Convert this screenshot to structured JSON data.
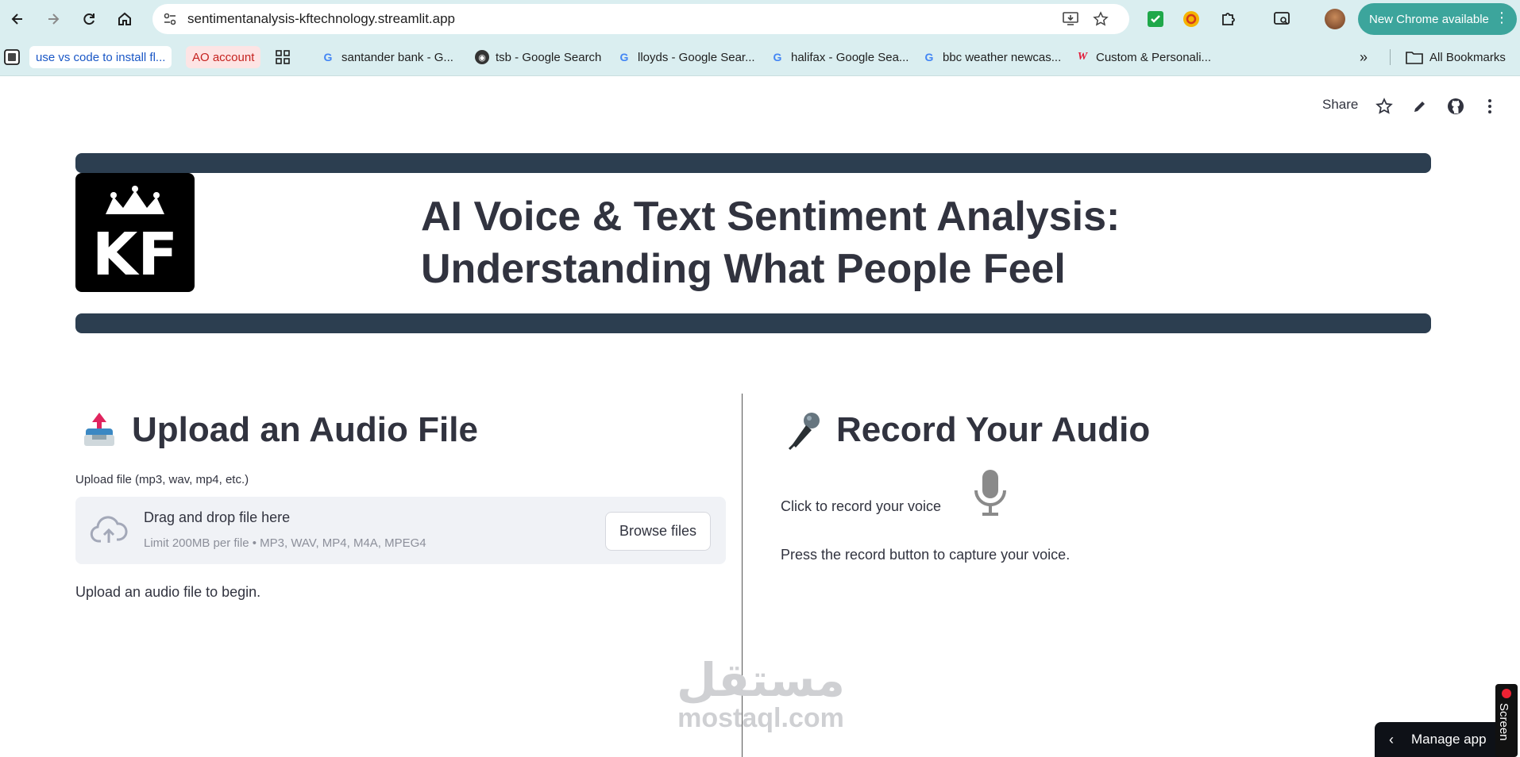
{
  "browser": {
    "url": "sentimentanalysis-kftechnology.streamlit.app",
    "update_label": "New Chrome available",
    "icons": [
      "back-arrow-icon",
      "forward-arrow-icon",
      "reload-icon",
      "home-icon",
      "site-settings-icon",
      "install-app-icon",
      "star-icon"
    ]
  },
  "bookmarks": {
    "items": [
      {
        "label": "use vs code to install fl...",
        "style": "chip-blue"
      },
      {
        "label": "AO account",
        "style": "chip-red"
      },
      {
        "label": "santander bank - G...",
        "icon": "google-icon"
      },
      {
        "label": "tsb - Google Search",
        "icon": "globe-icon"
      },
      {
        "label": "lloyds - Google Sear...",
        "icon": "google-icon"
      },
      {
        "label": "halifax - Google Sea...",
        "icon": "google-icon"
      },
      {
        "label": "bbc weather newcas...",
        "icon": "google-icon"
      },
      {
        "label": "Custom & Personali...",
        "icon": "walgreens-icon"
      }
    ],
    "all_label": "All Bookmarks"
  },
  "app": {
    "share_label": "Share",
    "title": "AI Voice & Text Sentiment Analysis: Understanding What People Feel",
    "logo_letters": "KF",
    "upload": {
      "heading": "Upload an Audio File",
      "field_label": "Upload file (mp3, wav, mp4, etc.)",
      "drop_text": "Drag and drop file here",
      "limit_text": "Limit 200MB per file • MP3, WAV, MP4, M4A, MPEG4",
      "browse_label": "Browse files",
      "hint": "Upload an audio file to begin."
    },
    "record": {
      "heading": "Record Your Audio",
      "prompt": "Click to record your voice",
      "hint": "Press the record button to capture your voice."
    },
    "manage_label": "Manage app"
  },
  "watermark": {
    "arabic": "مستقل",
    "latin": "mostaql.com"
  },
  "overlay": {
    "screen_rec_label": "Screen"
  },
  "colors": {
    "chrome_bg": "#daeef0",
    "band": "#2c3e50",
    "text": "#31333f",
    "dropzone": "#f0f2f6",
    "update_pill": "#3ca59c"
  }
}
